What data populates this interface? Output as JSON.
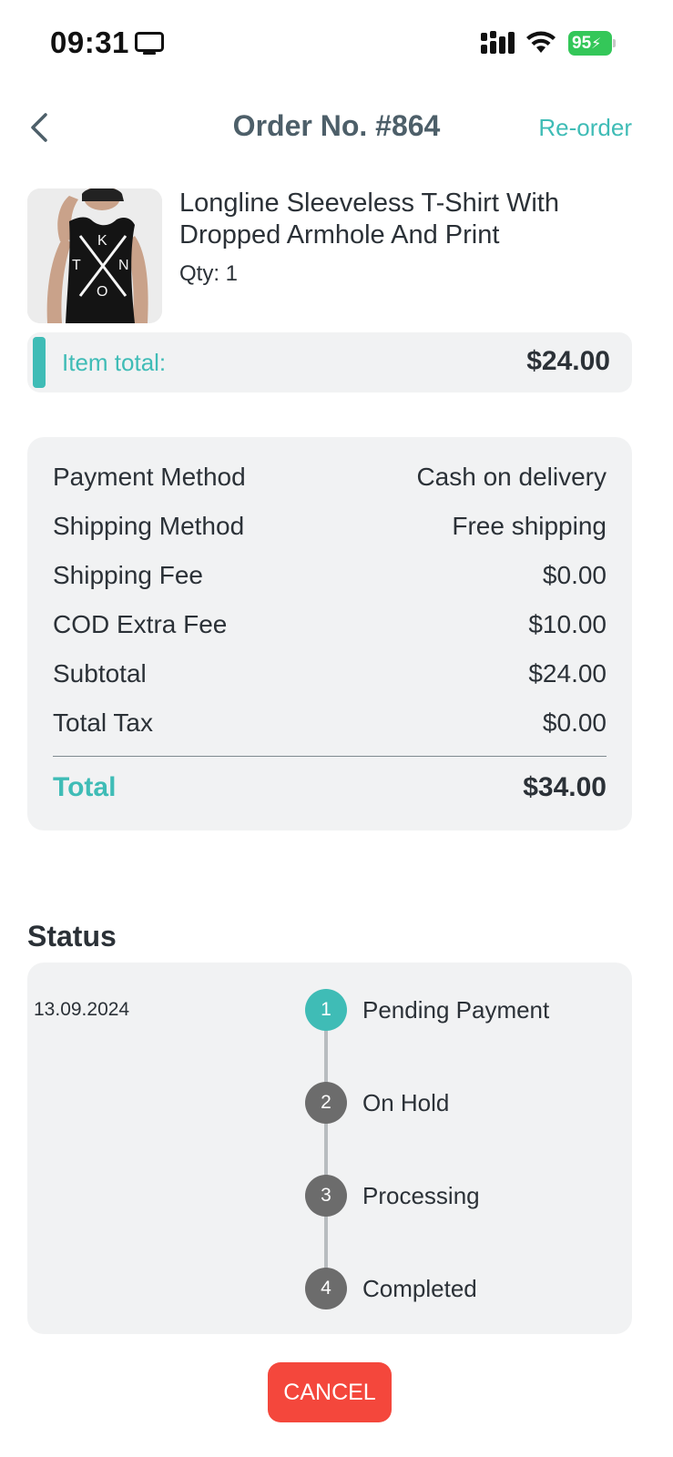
{
  "status_bar": {
    "time": "09:31",
    "battery": "95"
  },
  "header": {
    "title": "Order No. #864",
    "reorder_label": "Re-order"
  },
  "product": {
    "name": "Longline Sleeveless T-Shirt With Dropped Armhole And Print",
    "qty": "Qty: 1",
    "print_letters": [
      "K",
      "T",
      "N",
      "O"
    ]
  },
  "item_total": {
    "label": "Item total:",
    "value": "$24.00"
  },
  "summary": {
    "rows": [
      {
        "label": "Payment Method",
        "value": "Cash on delivery"
      },
      {
        "label": "Shipping Method",
        "value": "Free shipping"
      },
      {
        "label": "Shipping Fee",
        "value": "$0.00"
      },
      {
        "label": "COD Extra Fee",
        "value": "$10.00"
      },
      {
        "label": "Subtotal",
        "value": "$24.00"
      },
      {
        "label": "Total Tax",
        "value": "$0.00"
      }
    ],
    "total_label": "Total",
    "total_value": "$34.00"
  },
  "status": {
    "heading": "Status",
    "date": "13.09.2024",
    "steps": [
      {
        "number": "1",
        "label": "Pending Payment"
      },
      {
        "number": "2",
        "label": "On Hold"
      },
      {
        "number": "3",
        "label": "Processing"
      },
      {
        "number": "4",
        "label": "Completed"
      }
    ]
  },
  "cancel_label": "CANCEL",
  "colors": {
    "accent": "#3fbcb6",
    "danger": "#f4473c",
    "panel": "#f1f2f3"
  }
}
